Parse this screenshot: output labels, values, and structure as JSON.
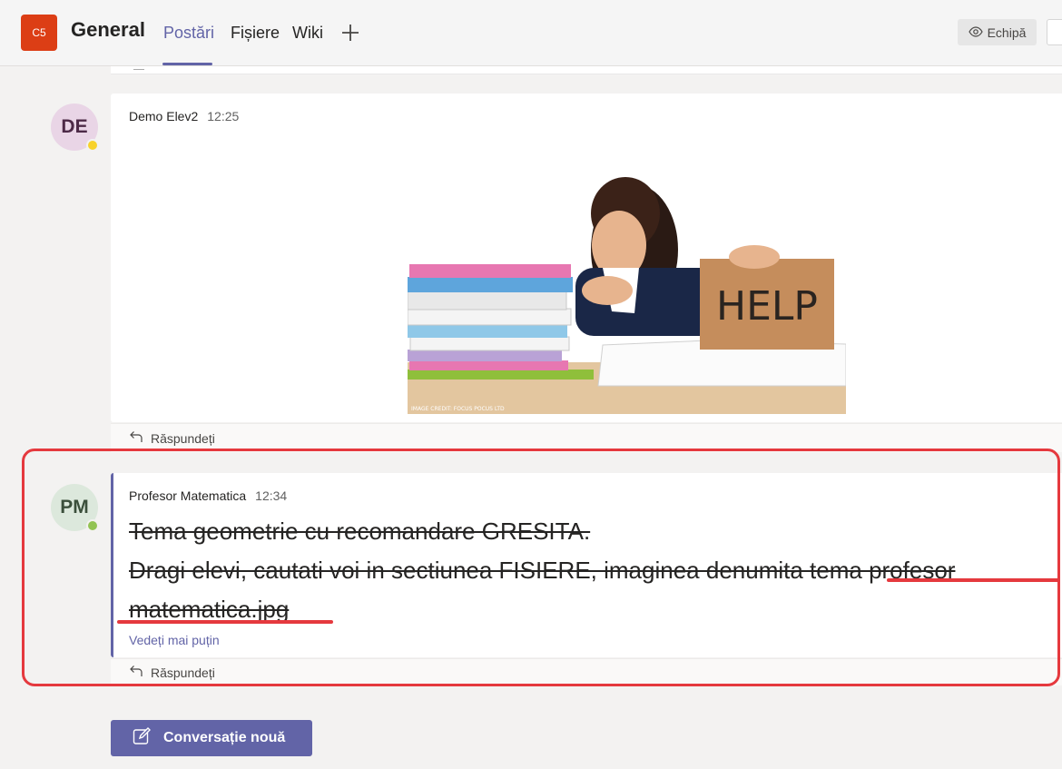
{
  "header": {
    "team_badge": "C5",
    "channel": "General",
    "tabs": [
      {
        "label": "Postări",
        "active": true
      },
      {
        "label": "Fișiere",
        "active": false
      },
      {
        "label": "Wiki",
        "active": false
      }
    ],
    "team_button": "Echipă",
    "accent_color": "#6264a7"
  },
  "messages": [
    {
      "avatar": "DE",
      "presence": "away",
      "author": "Demo Elev2",
      "time": "12:25",
      "image": {
        "sign_text": "HELP",
        "credit": "IMAGE CREDIT: FOCUS POCUS LTD"
      },
      "reply": "Răspundeți"
    },
    {
      "avatar": "PM",
      "presence": "online",
      "author": "Profesor Matematica",
      "time": "12:34",
      "lines": [
        "Tema geometrie cu recomandare GRESITA.",
        "Dragi elevi, cautati voi in sectiunea FISIERE, imaginea denumita tema profesor",
        "matematica.jpg"
      ],
      "see_less": "Vedeți mai puțin",
      "reply": "Răspundeți"
    }
  ],
  "new_conversation": "Conversație nouă",
  "annotation_color": "#e5393e"
}
